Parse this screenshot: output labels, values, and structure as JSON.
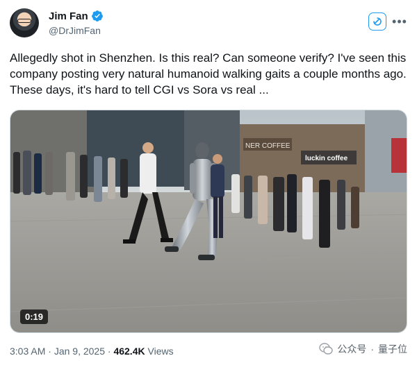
{
  "author": {
    "display_name": "Jim Fan",
    "handle": "@DrJimFan",
    "verified": true
  },
  "icons": {
    "verified": "verified-badge-icon",
    "grok": "grok-icon",
    "more": "more-icon",
    "watermark": "wechat-icon"
  },
  "tweet": {
    "text": "Allegedly shot in Shenzhen. Is this real? Can someone verify? I've seen this company posting very natural humanoid walking gaits a couple months ago. These days, it's hard to tell CGI vs Sora vs real ..."
  },
  "media": {
    "duration": "0:19",
    "signs": {
      "coffee": "NER COFFEE",
      "luckin": "luckin coffee"
    }
  },
  "meta": {
    "time": "3:03 AM",
    "separator": "·",
    "date": "Jan 9, 2025",
    "views_count": "462.4K",
    "views_label": "Views"
  },
  "watermark": {
    "source": "公众号",
    "separator": "·",
    "name": "量子位"
  },
  "colors": {
    "accent": "#1d9bf0",
    "text": "#0f1419",
    "secondary": "#536471"
  }
}
